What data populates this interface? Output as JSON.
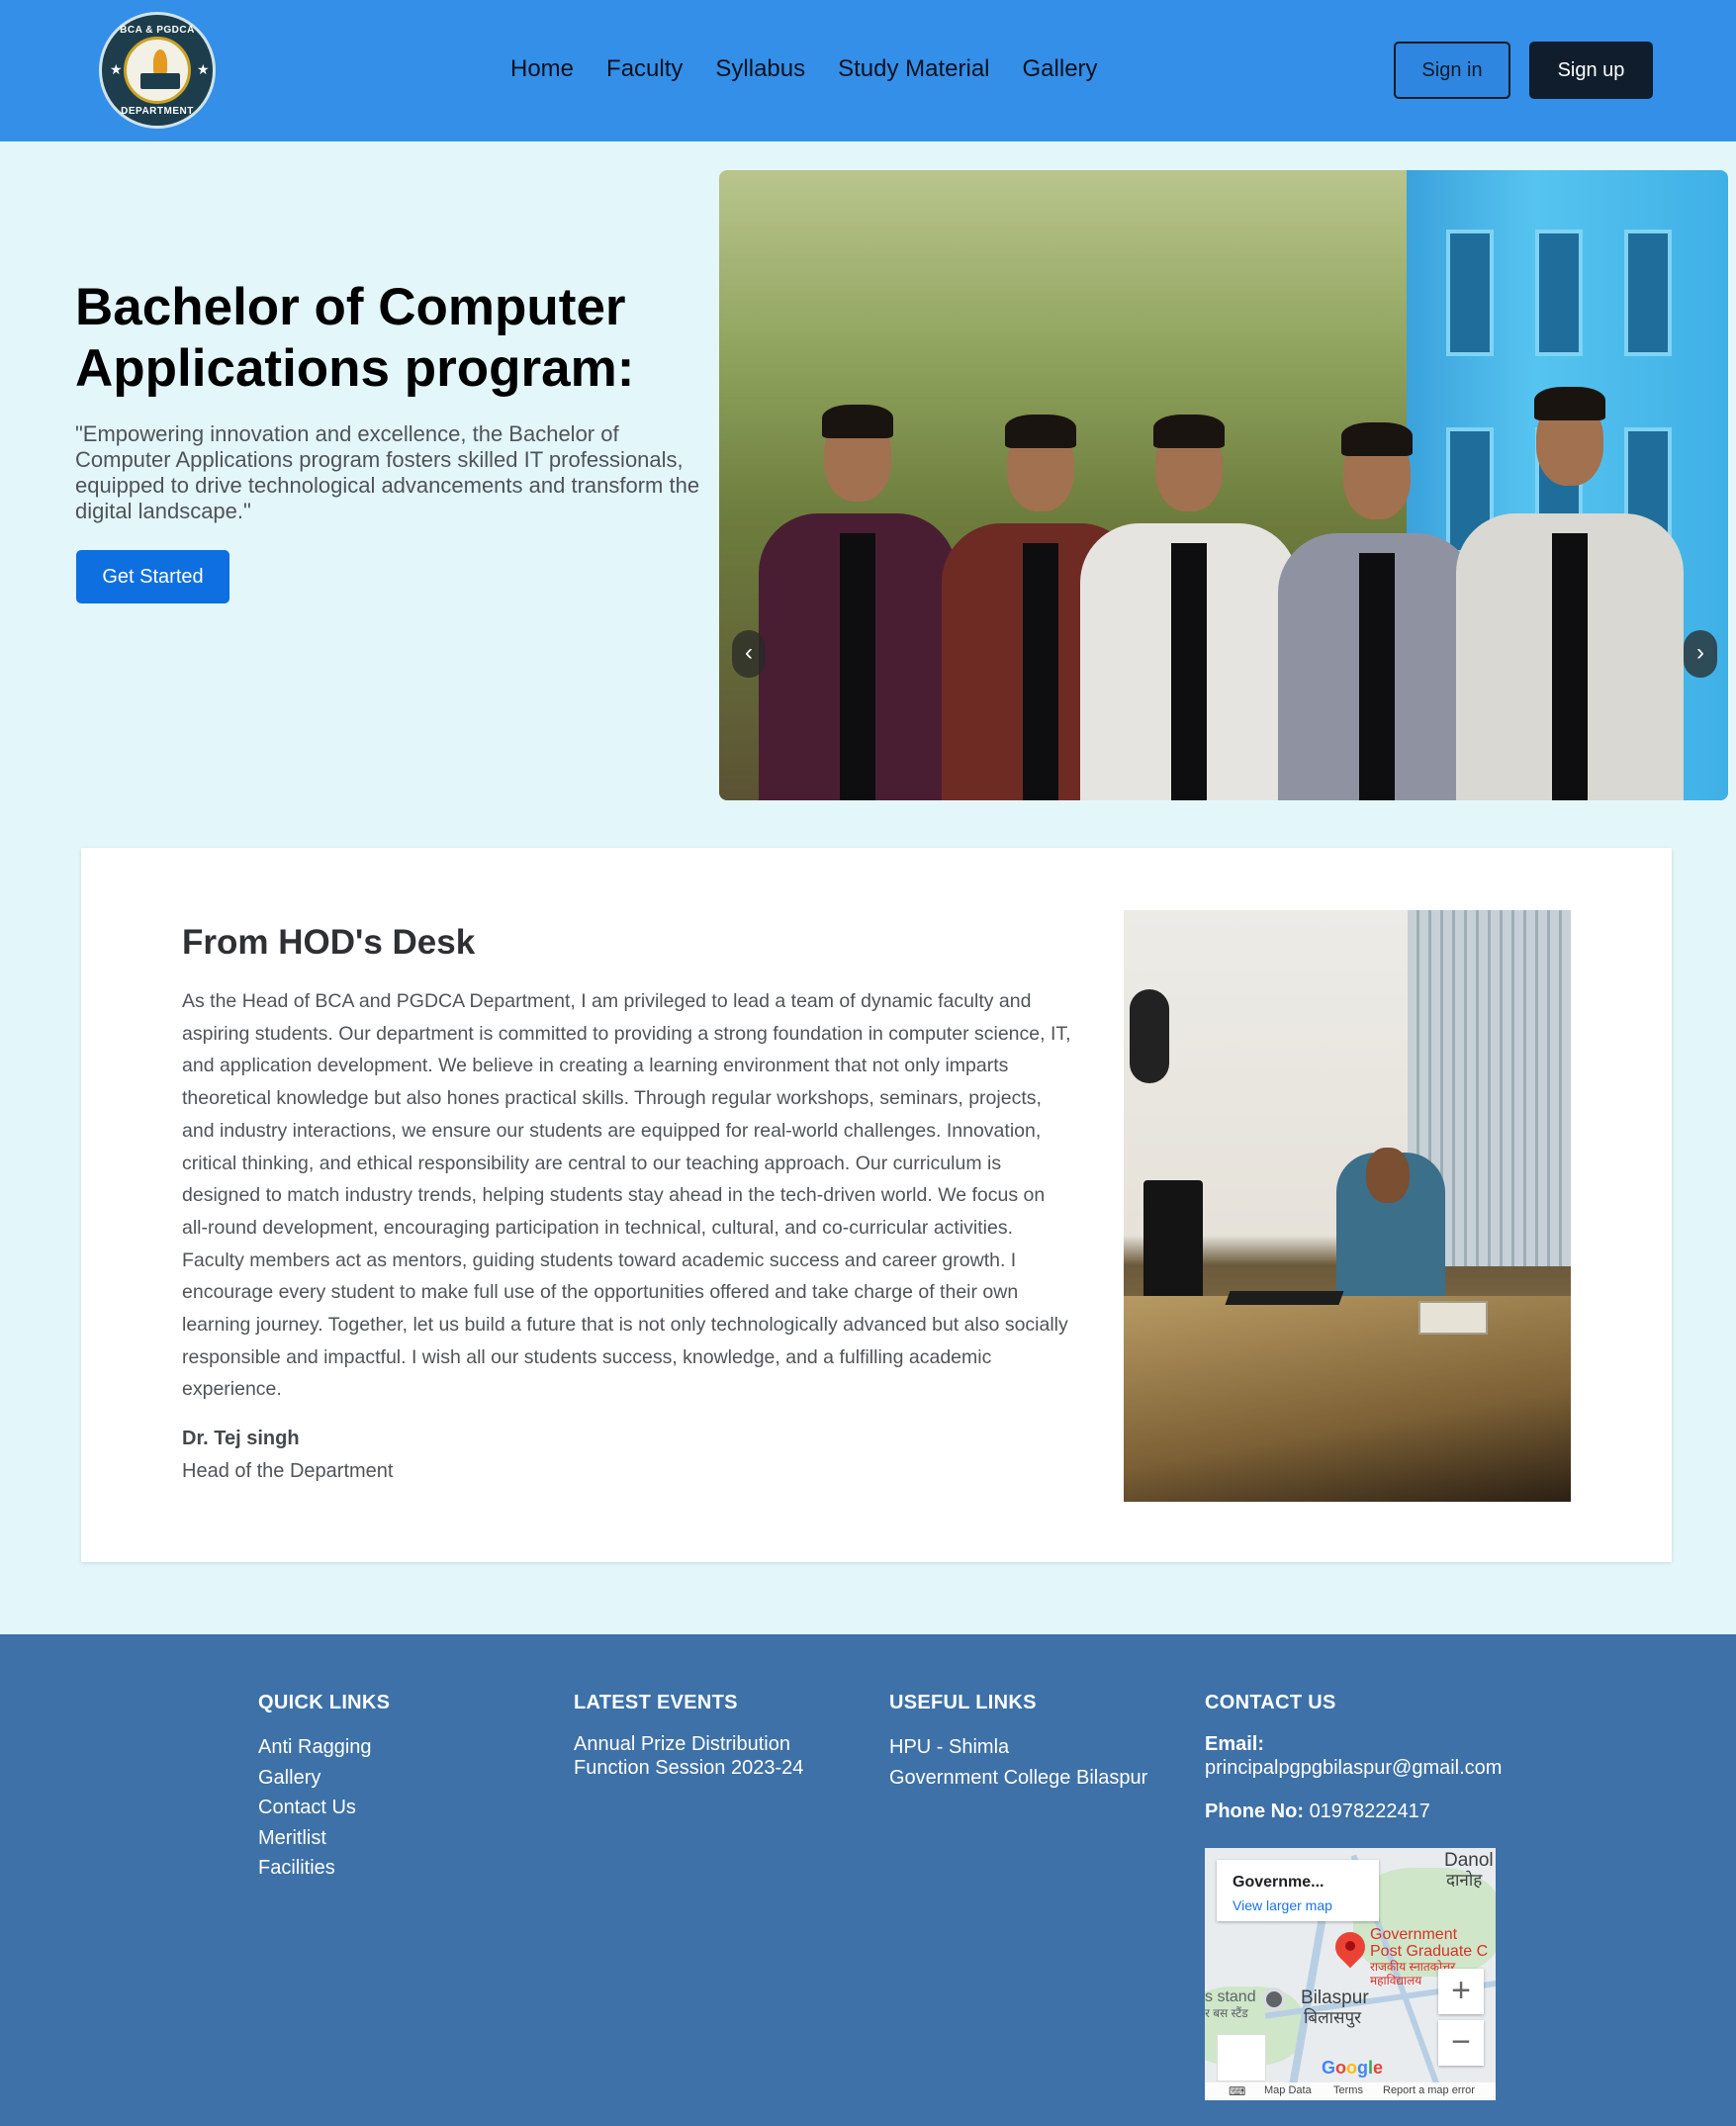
{
  "colors": {
    "navbar": "#348fe8",
    "page_bg": "#e3f7fa",
    "primary_button": "#0d6fe0",
    "signup_button": "#0f1d2c",
    "footer_bg": "#3d71a7"
  },
  "navbar": {
    "logo": {
      "top_text": "BCA & PGDCA",
      "bottom_text": "DEPARTMENT",
      "icon": "torch-book-emblem"
    },
    "links": [
      "Home",
      "Faculty",
      "Syllabus",
      "Study Material",
      "Gallery"
    ],
    "signin_label": "Sign in",
    "signup_label": "Sign up"
  },
  "hero": {
    "title": "Bachelor of Computer Applications program:",
    "quote": "\"Empowering innovation and excellence, the Bachelor of Computer Applications program fosters skilled IT professionals, equipped to drive technological advancements and transform the digital landscape.\"",
    "button_label": "Get Started",
    "carousel": {
      "prev_icon": "‹",
      "next_icon": "›"
    }
  },
  "hod": {
    "title": "From HOD's Desk",
    "message": "As the Head of BCA and PGDCA Department, I am privileged to lead a team of dynamic faculty and aspiring students. Our department is committed to providing a strong foundation in computer science, IT, and application development. We believe in creating a learning environment that not only imparts theoretical knowledge but also hones practical skills. Through regular workshops, seminars, projects, and industry interactions, we ensure our students are equipped for real-world challenges. Innovation, critical thinking, and ethical responsibility are central to our teaching approach. Our curriculum is designed to match industry trends, helping students stay ahead in the tech-driven world. We focus on all-round development, encouraging participation in technical, cultural, and co-curricular activities. Faculty members act as mentors, guiding students toward academic success and career growth. I encourage every student to make full use of the opportunities offered and take charge of their own learning journey. Together, let us build a future that is not only technologically advanced but also socially responsible and impactful. I wish all our students success, knowledge, and a fulfilling academic experience.",
    "name": "Dr. Tej singh",
    "role": "Head of the Department"
  },
  "footer": {
    "quick_links": {
      "heading": "QUICK LINKS",
      "items": [
        "Anti Ragging",
        "Gallery",
        "Contact Us",
        "Meritlist",
        "Facilities"
      ]
    },
    "latest_events": {
      "heading": "LATEST EVENTS",
      "items": [
        "Annual Prize Distribution Function Session 2023-24"
      ]
    },
    "useful_links": {
      "heading": "USEFUL LINKS",
      "items": [
        "HPU - Shimla",
        "Government College Bilaspur"
      ]
    },
    "contact": {
      "heading": "CONTACT US",
      "email_label": "Email:",
      "email": "principalpgpgbilaspur@gmail.com",
      "phone_label": "Phone No:",
      "phone": "01978222417"
    },
    "map": {
      "card_title": "Governme...",
      "card_link": "View larger map",
      "place_lines": [
        "Government",
        "Post Graduate C",
        "राजकीय स्नातकोत्तर",
        "महाविद्यालय"
      ],
      "town": "Bilaspur",
      "town_hindi": "बिलासपुर",
      "top_right": "Danol",
      "top_right_hindi": "दानोह",
      "bus_stand": "s stand",
      "bus_stand_hindi": "र बस स्टैंड",
      "zoom_in": "+",
      "zoom_out": "−",
      "google": "Google",
      "attribution": [
        "Map Data",
        "Terms",
        "Report a map error"
      ]
    }
  }
}
